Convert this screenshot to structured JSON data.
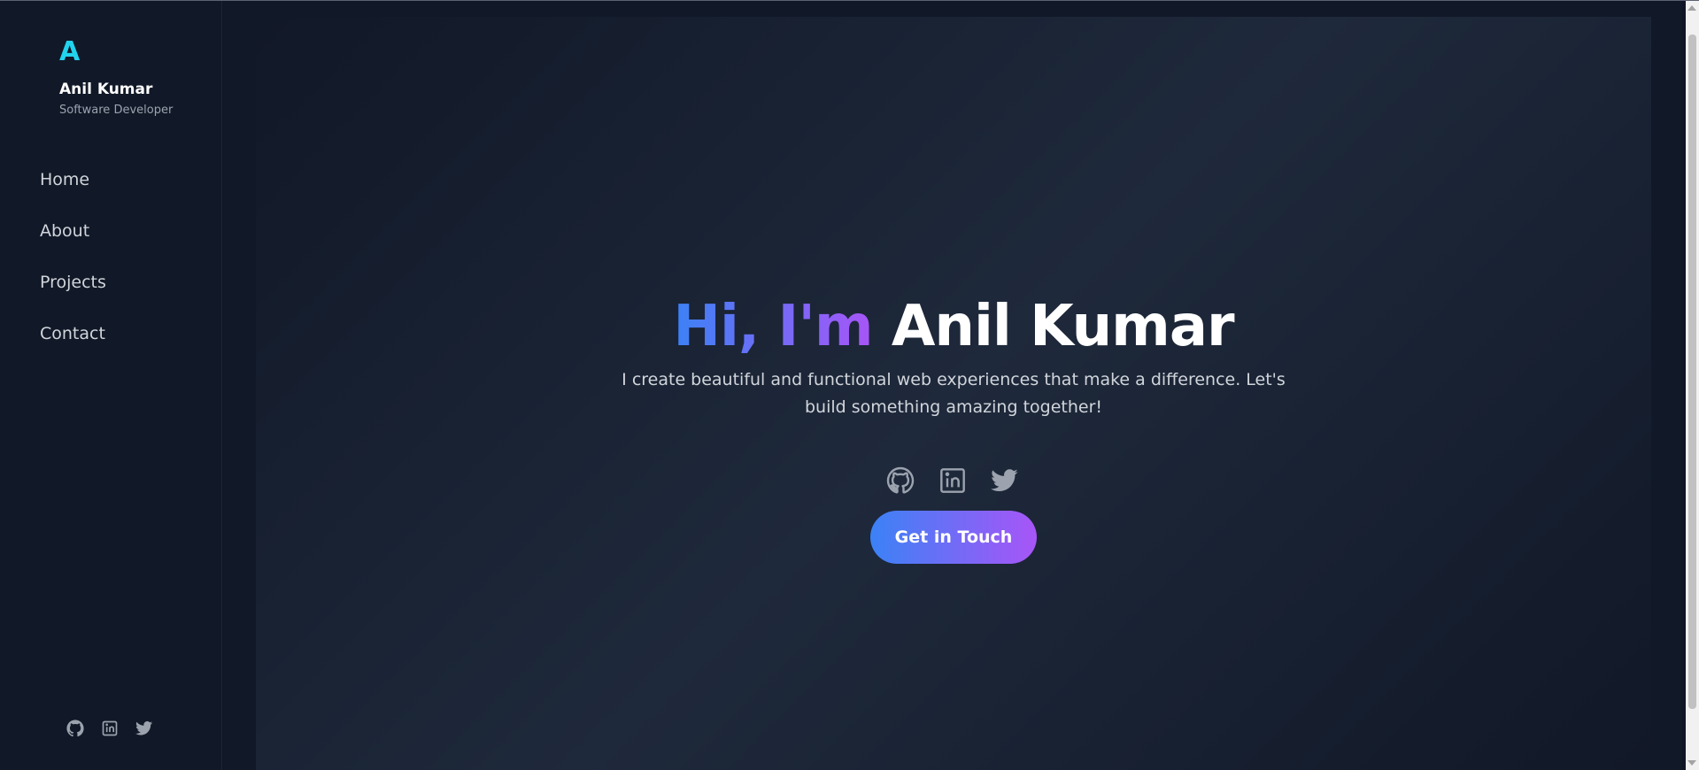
{
  "sidebar": {
    "logo_letter": "A",
    "name": "Anil Kumar",
    "role": "Software Developer",
    "nav": [
      {
        "label": "Home"
      },
      {
        "label": "About"
      },
      {
        "label": "Projects"
      },
      {
        "label": "Contact"
      }
    ],
    "social_icons": [
      "github-icon",
      "linkedin-icon",
      "twitter-icon"
    ]
  },
  "hero": {
    "greeting": "Hi, I'm",
    "name": "Anil Kumar",
    "subtitle": "I create beautiful and functional web experiences that make a difference. Let's build something amazing together!",
    "social_icons": [
      "github-icon",
      "linkedin-icon",
      "twitter-icon"
    ],
    "cta_label": "Get in Touch"
  },
  "colors": {
    "accent_cyan": "#22d3ee",
    "gradient_start": "#3b82f6",
    "gradient_end": "#a855f7",
    "background": "#111827"
  }
}
